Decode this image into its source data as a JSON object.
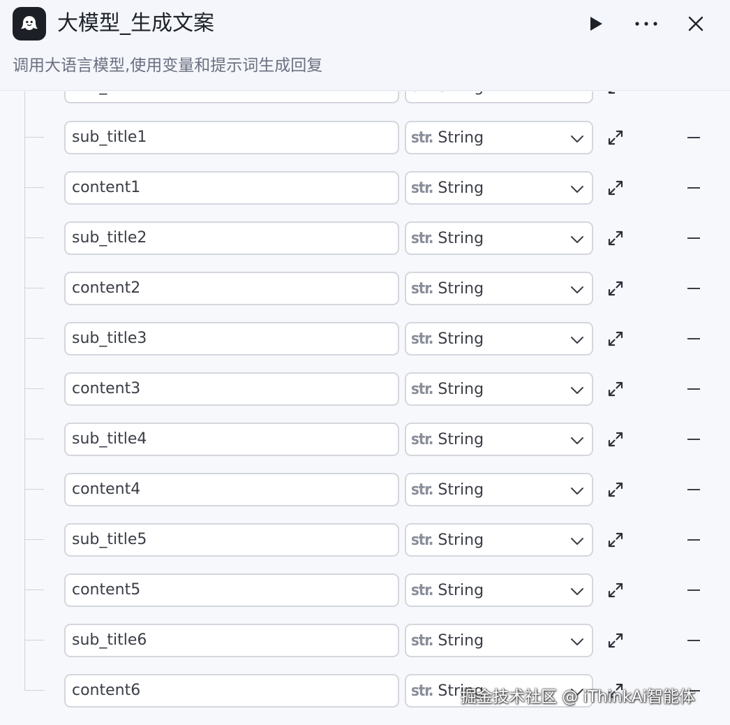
{
  "header": {
    "logo_icon": "ghost-bot-icon",
    "title": "大模型_生成文案",
    "description": "调用大语言模型,使用变量和提示词生成回复",
    "run_icon": "play-icon",
    "more_icon": "more-horizontal-icon",
    "close_icon": "close-icon"
  },
  "outputs": {
    "partial_row": {
      "name": "sub_title",
      "type_prefix": "str.",
      "type": "String"
    },
    "rows": [
      {
        "name": "sub_title1",
        "type_prefix": "str.",
        "type": "String"
      },
      {
        "name": "content1",
        "type_prefix": "str.",
        "type": "String"
      },
      {
        "name": "sub_title2",
        "type_prefix": "str.",
        "type": "String"
      },
      {
        "name": "content2",
        "type_prefix": "str.",
        "type": "String"
      },
      {
        "name": "sub_title3",
        "type_prefix": "str.",
        "type": "String"
      },
      {
        "name": "content3",
        "type_prefix": "str.",
        "type": "String"
      },
      {
        "name": "sub_title4",
        "type_prefix": "str.",
        "type": "String"
      },
      {
        "name": "content4",
        "type_prefix": "str.",
        "type": "String"
      },
      {
        "name": "sub_title5",
        "type_prefix": "str.",
        "type": "String"
      },
      {
        "name": "content5",
        "type_prefix": "str.",
        "type": "String"
      },
      {
        "name": "sub_title6",
        "type_prefix": "str.",
        "type": "String"
      },
      {
        "name": "content6",
        "type_prefix": "str.",
        "type": "String"
      }
    ]
  },
  "watermark": "掘金技术社区 @ iThinkAi智能体"
}
